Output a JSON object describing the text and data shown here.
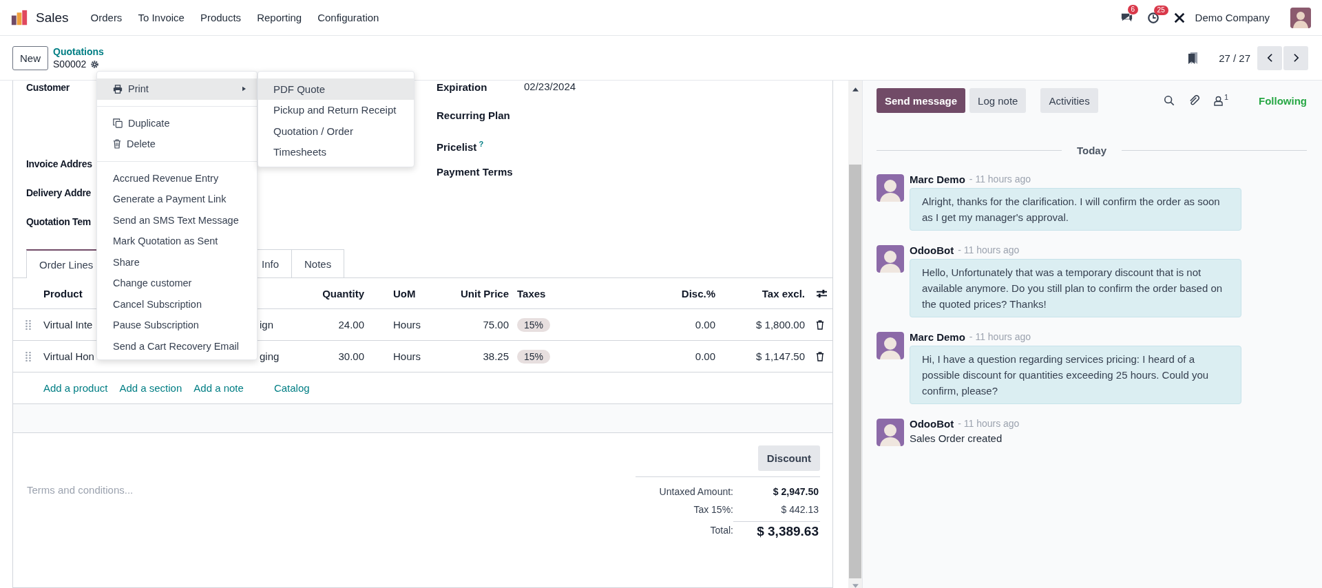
{
  "navbar": {
    "app_name": "Sales",
    "menu": [
      "Orders",
      "To Invoice",
      "Products",
      "Reporting",
      "Configuration"
    ],
    "messages_badge": "6",
    "activities_badge": "25",
    "company": "Demo Company"
  },
  "control_panel": {
    "new_button": "New",
    "breadcrumb": "Quotations",
    "record": "S00002",
    "pager": "27 / 27"
  },
  "form": {
    "fields_left": [
      {
        "label": "Customer"
      },
      {
        "label": "Invoice Addres"
      },
      {
        "label": "Delivery Addre"
      },
      {
        "label": "Quotation Tem"
      }
    ],
    "fields_right": [
      {
        "label": "Expiration",
        "value": "02/23/2024"
      },
      {
        "label": "Recurring Plan"
      },
      {
        "label": "Pricelist",
        "help": "?"
      },
      {
        "label": "Payment Terms"
      }
    ],
    "tabs": [
      {
        "label": "Order Lines",
        "selected": true
      },
      {
        "label": "Info",
        "selected": false
      },
      {
        "label": "Notes",
        "selected": false
      }
    ],
    "table": {
      "columns": [
        "Product",
        "Quantity",
        "UoM",
        "Unit Price",
        "Taxes",
        "Disc.%",
        "Tax excl."
      ],
      "rows": [
        {
          "product_start": "Virtual Inte",
          "product_end": "ign",
          "quantity": "24.00",
          "uom": "Hours",
          "unit_price": "75.00",
          "taxes": "15%",
          "discount": "0.00",
          "subtotal": "$ 1,800.00"
        },
        {
          "product_start": "Virtual Hon",
          "product_end": "ging",
          "quantity": "30.00",
          "uom": "Hours",
          "unit_price": "38.25",
          "taxes": "15%",
          "discount": "0.00",
          "subtotal": "$ 1,147.50"
        }
      ]
    },
    "add_links": [
      "Add a product",
      "Add a section",
      "Add a note",
      "Catalog"
    ],
    "terms_placeholder": "Terms and conditions...",
    "discount_button": "Discount",
    "totals": [
      {
        "label": "Untaxed Amount:",
        "value": "$ 2,947.50",
        "kind": "subtotal"
      },
      {
        "label": "Tax 15%:",
        "value": "$ 442.13",
        "kind": "tax"
      },
      {
        "label": "Total:",
        "value": "$ 3,389.63",
        "kind": "total"
      }
    ]
  },
  "action_menu": {
    "groups": [
      [
        {
          "label": "Print",
          "kind": "print",
          "selected": true
        }
      ],
      [
        {
          "label": "Duplicate",
          "kind": "duplicate",
          "selected": false
        },
        {
          "label": "Delete",
          "kind": "delete",
          "selected": false
        }
      ],
      [
        {
          "label": "Accrued Revenue Entry",
          "kind": "plain",
          "selected": false
        },
        {
          "label": "Generate a Payment Link",
          "kind": "plain",
          "selected": false
        },
        {
          "label": "Send an SMS Text Message",
          "kind": "plain",
          "selected": false
        },
        {
          "label": "Mark Quotation as Sent",
          "kind": "plain",
          "selected": false
        },
        {
          "label": "Share",
          "kind": "plain",
          "selected": false
        },
        {
          "label": "Change customer",
          "kind": "plain",
          "selected": false
        },
        {
          "label": "Cancel Subscription",
          "kind": "plain",
          "selected": false
        },
        {
          "label": "Pause Subscription",
          "kind": "plain",
          "selected": false
        },
        {
          "label": "Send a Cart Recovery Email",
          "kind": "plain",
          "selected": false
        }
      ]
    ],
    "print_submenu": [
      {
        "label": "PDF Quote",
        "selected": true
      },
      {
        "label": "Pickup and Return Receipt",
        "selected": false
      },
      {
        "label": "Quotation / Order",
        "selected": false
      },
      {
        "label": "Timesheets",
        "selected": false
      }
    ]
  },
  "chatter": {
    "buttons": [
      {
        "label": "Send message",
        "selected": true
      },
      {
        "label": "Log note",
        "selected": false
      }
    ],
    "activities_button": "Activities",
    "followers_count": "1",
    "follow_button": "Following",
    "date_separator": "Today",
    "messages": [
      {
        "author": "Marc Demo",
        "time": "- 11 hours ago",
        "body": "Alright, thanks for the clarification. I will confirm the order as soon as I get my manager's approval.",
        "kind": "comment"
      },
      {
        "author": "OdooBot",
        "time": "- 11 hours ago",
        "body": "Hello, Unfortunately that was a temporary discount that is not available anymore. Do you still plan to confirm the order based on the quoted prices? Thanks!",
        "kind": "comment"
      },
      {
        "author": "Marc Demo",
        "time": "- 11 hours ago",
        "body": "Hi, I have a question regarding services pricing: I heard of a possible discount for quantities exceeding 25 hours. Could you confirm, please?",
        "kind": "comment"
      },
      {
        "author": "OdooBot",
        "time": "- 11 hours ago",
        "body": "Sales Order created",
        "kind": "notification"
      }
    ]
  }
}
